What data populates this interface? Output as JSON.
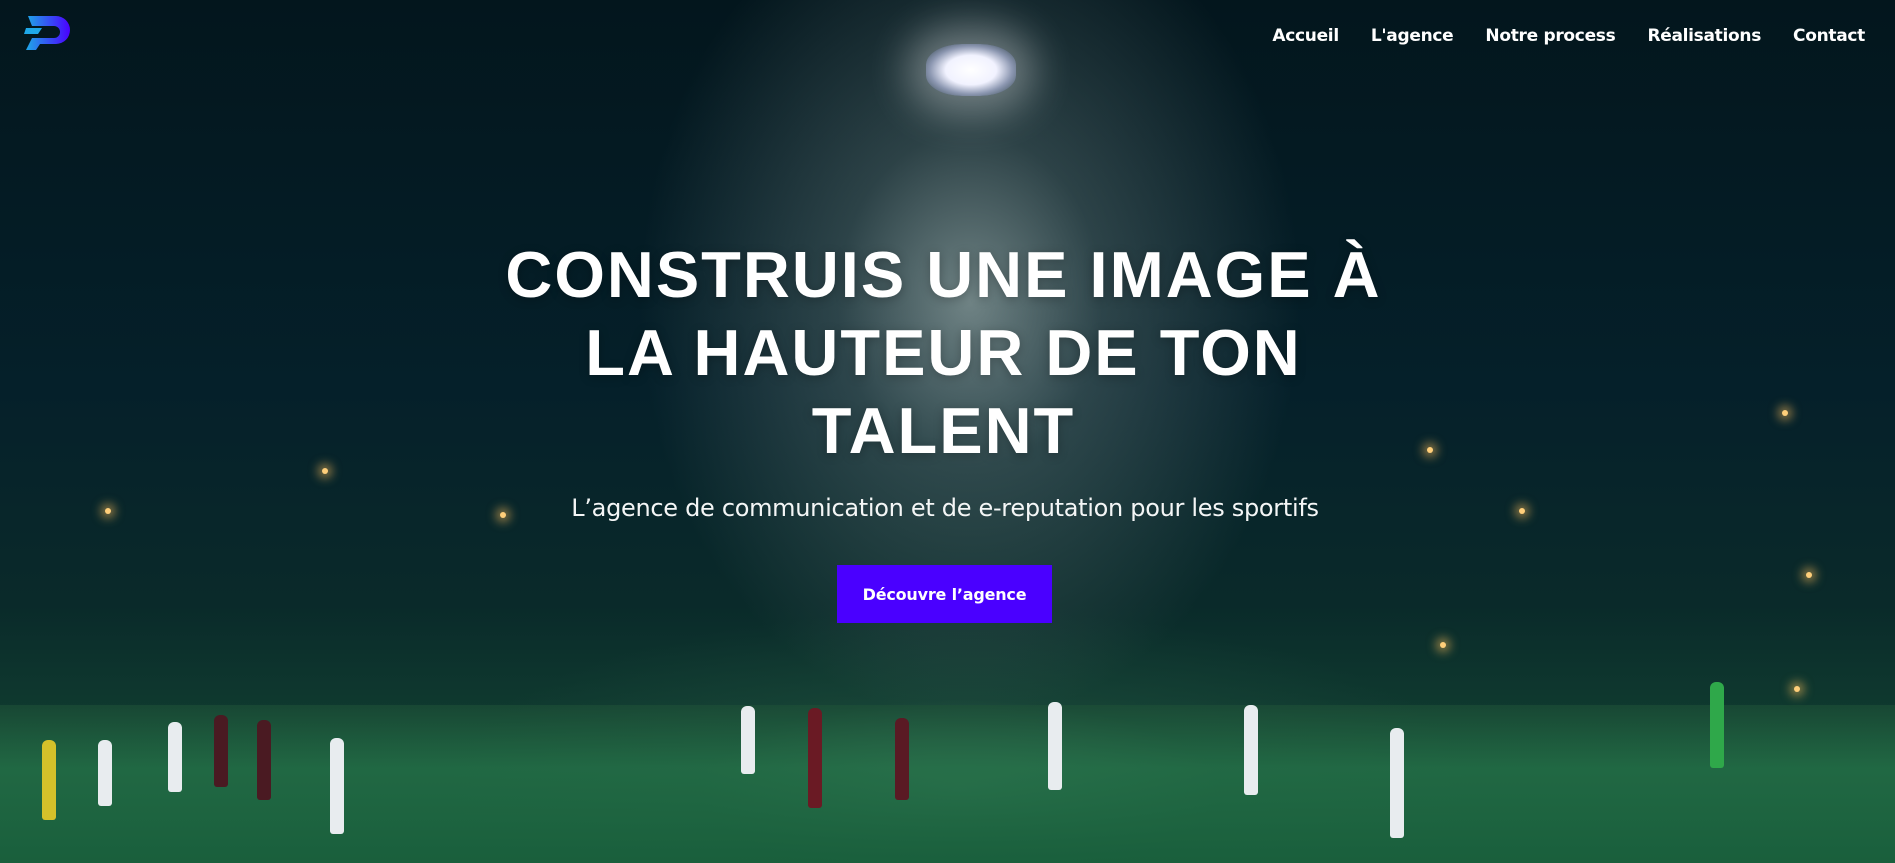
{
  "nav": {
    "items": [
      {
        "label": "Accueil"
      },
      {
        "label": "L'agence"
      },
      {
        "label": "Notre process"
      },
      {
        "label": "Réalisations"
      },
      {
        "label": "Contact"
      }
    ]
  },
  "hero": {
    "headline": "CONSTRUIS UNE IMAGE À LA HAUTEUR DE TON TALENT",
    "subtitle": "L’agence de communication et de e-reputation pour les sportifs",
    "cta_label": "Découvre l’agence",
    "cta_color": "#4a00ff"
  },
  "logo": {
    "icon": "p-logo-icon",
    "colors": [
      "#1fa8e8",
      "#4a00ff"
    ]
  }
}
